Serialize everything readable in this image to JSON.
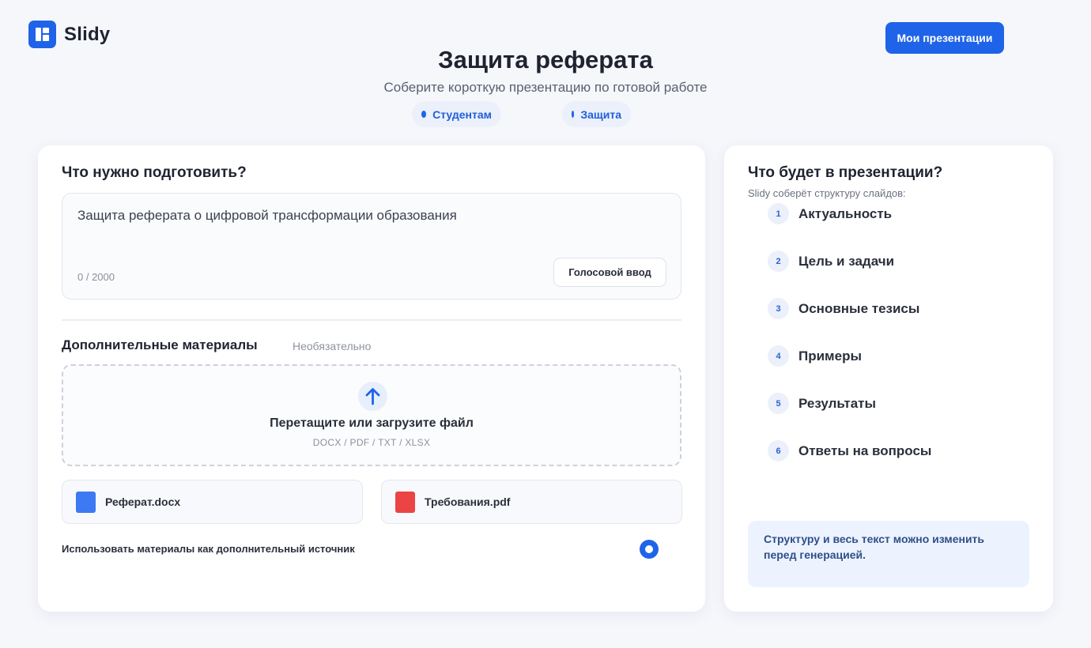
{
  "brand": {
    "name": "Slidy"
  },
  "header": {
    "my_presentations": "Мои презентации",
    "title": "Защита реферата",
    "subtitle": "Соберите короткую презентацию по готовой работе",
    "tags": [
      "Студентам",
      "Защита"
    ]
  },
  "prepare": {
    "heading": "Что нужно подготовить?",
    "input_value": "Защита реферата о цифровой трансформации образования",
    "counter": "0 / 2000",
    "voice_button": "Голосовой ввод"
  },
  "materials": {
    "heading": "Дополнительные материалы",
    "optional": "Необязательно",
    "upload_title": "Перетащите или загрузите файл",
    "upload_formats": "DOCX / PDF / TXT / XLSX",
    "files": [
      {
        "name": "Реферат.docx",
        "color": "#3d79f2"
      },
      {
        "name": "Требования.pdf",
        "color": "#ec4444"
      }
    ],
    "use_as_source": "Использовать материалы как дополнительный источник",
    "use_as_source_selected": true
  },
  "preview": {
    "heading": "Что будет в презентации?",
    "subtitle": "Slidy соберёт структуру слайдов:",
    "steps": [
      {
        "num": "1",
        "label": "Актуальность"
      },
      {
        "num": "2",
        "label": "Цель и задачи"
      },
      {
        "num": "3",
        "label": "Основные тезисы"
      },
      {
        "num": "4",
        "label": "Примеры"
      },
      {
        "num": "5",
        "label": "Результаты"
      },
      {
        "num": "6",
        "label": "Ответы на вопросы"
      }
    ],
    "note": "Структуру и весь текст можно изменить перед генерацией."
  },
  "colors": {
    "accent": "#1f63e8",
    "background": "#f6f7fb"
  }
}
